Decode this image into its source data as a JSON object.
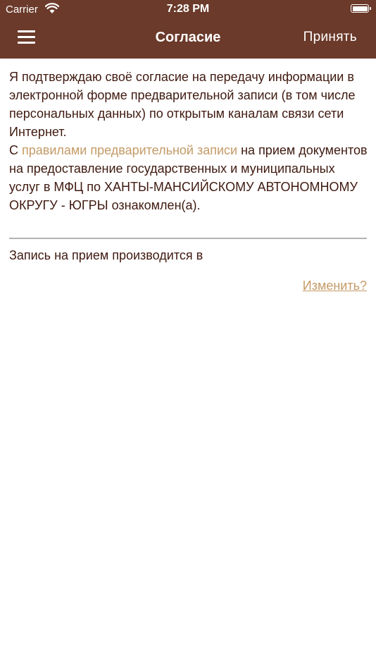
{
  "status_bar": {
    "carrier": "Carrier",
    "time": "7:28 PM"
  },
  "nav": {
    "title": "Согласие",
    "accept_label": "Принять",
    "menu_icon": "hamburger-menu-icon"
  },
  "consent": {
    "line1": "Я подтверждаю своё согласие на передачу информации в электронной форме предварительной записи (в том числе персональных данных) по открытым каналам связи сети Интернет.",
    "line2_prefix": "С ",
    "rules_link": "правилами предварительной записи",
    "line2_suffix": " на прием документов на предоставление государственных и муниципальных услуг в МФЦ по ХАНТЫ-МАНСИЙСКОМУ АВТОНОМНОМУ ОКРУГУ - ЮГРЫ ознакомлен(а)."
  },
  "appointment": {
    "text": "Запись на прием производится в",
    "change_label": "Изменить?"
  },
  "colors": {
    "header_bg": "#6b3a2a",
    "text": "#3f1a10",
    "link": "#c49a66",
    "divider": "#b3b3b3"
  }
}
